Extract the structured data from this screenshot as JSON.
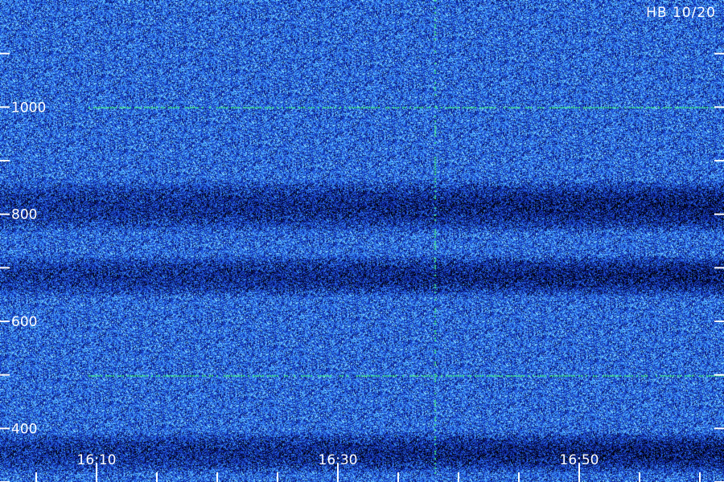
{
  "stamp": "HB 10/20",
  "chart_data": {
    "type": "heatmap",
    "colormap": [
      "#000000",
      "#0a1a8c",
      "#1f4fe0",
      "#3fa6ff",
      "#9ff0ff"
    ],
    "ylim": [
      300,
      1200
    ],
    "xlim": [
      "16:02",
      "17:02"
    ],
    "y_ticks_labeled": [
      400,
      600,
      800,
      1000
    ],
    "y_ticks_minor": [
      300,
      500,
      700,
      900,
      1100
    ],
    "x_ticks_labeled": [
      "16:10",
      "16:30",
      "16:50"
    ],
    "x_ticks_minor": [
      "16:05",
      "16:15",
      "16:20",
      "16:25",
      "16:35",
      "16:40",
      "16:45",
      "16:55",
      "17:00"
    ],
    "horizontal_lines": [
      {
        "y": 1000,
        "color": "#3fe08a"
      },
      {
        "y": 500,
        "color": "#3fe08a"
      }
    ],
    "vertical_lines": [
      {
        "x": "16:38",
        "color": "#3fe08a"
      }
    ],
    "dark_bands": [
      {
        "y_from": 330,
        "y_to": 380
      },
      {
        "y_from": 780,
        "y_to": 850
      },
      {
        "y_from": 660,
        "y_to": 710
      }
    ]
  }
}
